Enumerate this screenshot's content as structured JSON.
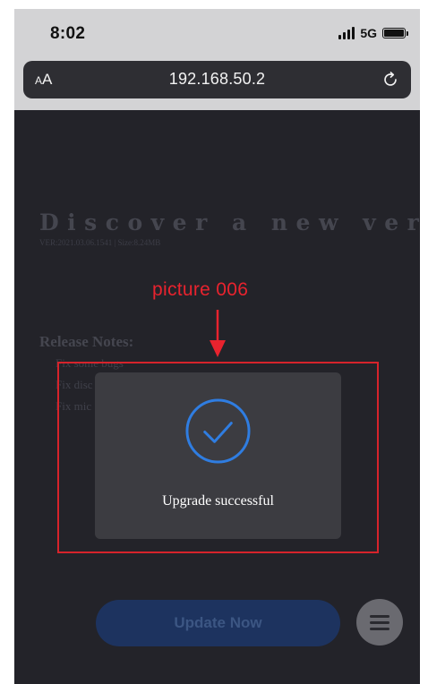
{
  "status_bar": {
    "time": "8:02",
    "network": "5G"
  },
  "browser": {
    "text_size_small": "A",
    "text_size_large": "A",
    "url": "192.168.50.2"
  },
  "page": {
    "headline": "Discover a new version",
    "meta": "VER:2021.03.06.1541 | Size:8.24MB",
    "notes_title": "Release Notes:",
    "notes": [
      "Fix some bugs",
      "Fix disc",
      "Fix mic"
    ],
    "update_button": "Update Now"
  },
  "modal": {
    "message": "Upgrade successful",
    "icon": "check-circle-icon",
    "accent": "#2f7de1"
  },
  "annotation": {
    "label": "picture 006",
    "color": "#e8232e"
  }
}
